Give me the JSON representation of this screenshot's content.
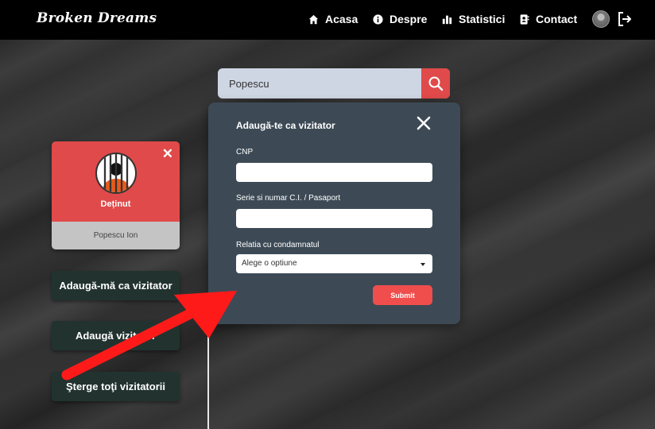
{
  "navbar": {
    "brand": "Broken Dreams",
    "items": [
      {
        "label": "Acasa",
        "icon": "home-icon"
      },
      {
        "label": "Despre",
        "icon": "info-icon"
      },
      {
        "label": "Statistici",
        "icon": "bar-chart-icon"
      },
      {
        "label": "Contact",
        "icon": "contact-card-icon"
      }
    ],
    "avatar_icon": "user-avatar",
    "logout_icon": "logout-icon"
  },
  "search": {
    "value": "Popescu",
    "button_icon": "search-icon",
    "button_color": "#e04a4a"
  },
  "inmate_card": {
    "role": "Deținut",
    "name": "Popescu Ion",
    "close_icon": "close-icon",
    "avatar_icon": "prisoner-avatar-icon",
    "header_color": "#e04a4a"
  },
  "actions": {
    "add_me": "Adaugă-mă ca vizitator",
    "add_visitor": "Adaugă vizitator",
    "delete_all": "Şterge toţi vizitatorii"
  },
  "modal": {
    "title": "Adaugă-te ca vizitator",
    "close_icon": "close-icon",
    "fields": {
      "cnp_label": "CNP",
      "id_label": "Serie si numar C.I. / Pasaport",
      "relation_label": "Relatia cu condamnatul",
      "relation_selected": "Alege o optiune"
    },
    "submit_label": "Submit",
    "background": "#3d4a56",
    "submit_color": "#f04d4d"
  },
  "annotation": {
    "arrow_color": "#ff1a1a"
  }
}
